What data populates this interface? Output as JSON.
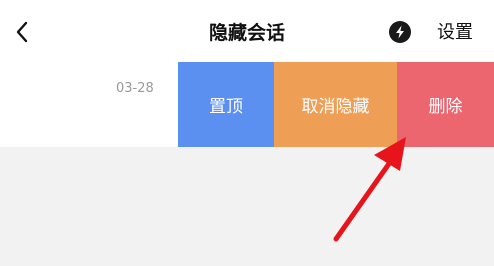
{
  "header": {
    "back_icon": "chevron-left-icon",
    "title": "隐藏会话",
    "quick_icon": "lightning-bolt-icon",
    "settings_label": "设置"
  },
  "conversation": {
    "date": "03-28",
    "actions": {
      "pin_label": "置顶",
      "unhide_label": "取消隐藏",
      "delete_label": "删除"
    }
  },
  "annotation": {
    "arrow_icon": "red-pointer-arrow-icon",
    "arrow_color": "#e8141c"
  },
  "colors": {
    "pin": "#5b8ff0",
    "unhide": "#ee9e55",
    "delete": "#ec6670",
    "background": "#f2f2f2"
  }
}
